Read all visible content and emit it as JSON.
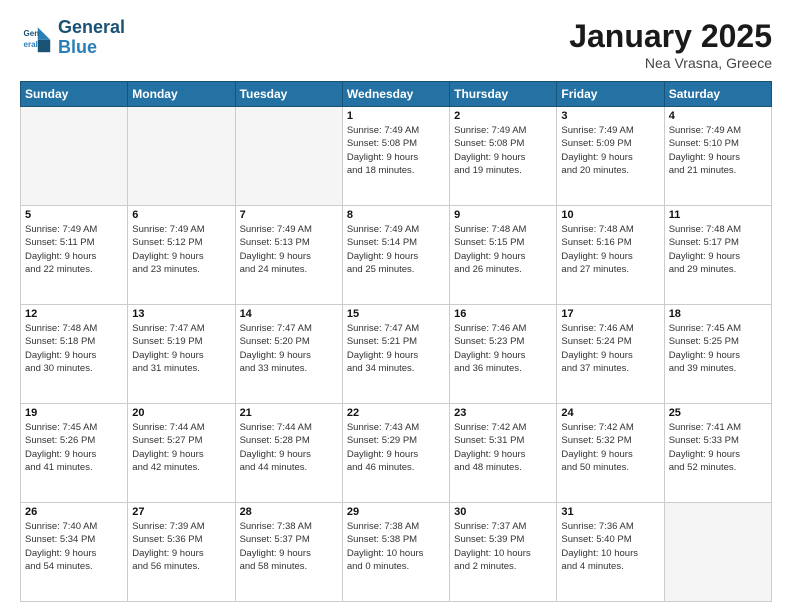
{
  "header": {
    "logo_line1": "General",
    "logo_line2": "Blue",
    "month_title": "January 2025",
    "location": "Nea Vrasna, Greece"
  },
  "weekdays": [
    "Sunday",
    "Monday",
    "Tuesday",
    "Wednesday",
    "Thursday",
    "Friday",
    "Saturday"
  ],
  "weeks": [
    [
      {
        "num": "",
        "info": "",
        "empty": true
      },
      {
        "num": "",
        "info": "",
        "empty": true
      },
      {
        "num": "",
        "info": "",
        "empty": true
      },
      {
        "num": "1",
        "info": "Sunrise: 7:49 AM\nSunset: 5:08 PM\nDaylight: 9 hours\nand 18 minutes.",
        "empty": false
      },
      {
        "num": "2",
        "info": "Sunrise: 7:49 AM\nSunset: 5:08 PM\nDaylight: 9 hours\nand 19 minutes.",
        "empty": false
      },
      {
        "num": "3",
        "info": "Sunrise: 7:49 AM\nSunset: 5:09 PM\nDaylight: 9 hours\nand 20 minutes.",
        "empty": false
      },
      {
        "num": "4",
        "info": "Sunrise: 7:49 AM\nSunset: 5:10 PM\nDaylight: 9 hours\nand 21 minutes.",
        "empty": false
      }
    ],
    [
      {
        "num": "5",
        "info": "Sunrise: 7:49 AM\nSunset: 5:11 PM\nDaylight: 9 hours\nand 22 minutes.",
        "empty": false
      },
      {
        "num": "6",
        "info": "Sunrise: 7:49 AM\nSunset: 5:12 PM\nDaylight: 9 hours\nand 23 minutes.",
        "empty": false
      },
      {
        "num": "7",
        "info": "Sunrise: 7:49 AM\nSunset: 5:13 PM\nDaylight: 9 hours\nand 24 minutes.",
        "empty": false
      },
      {
        "num": "8",
        "info": "Sunrise: 7:49 AM\nSunset: 5:14 PM\nDaylight: 9 hours\nand 25 minutes.",
        "empty": false
      },
      {
        "num": "9",
        "info": "Sunrise: 7:48 AM\nSunset: 5:15 PM\nDaylight: 9 hours\nand 26 minutes.",
        "empty": false
      },
      {
        "num": "10",
        "info": "Sunrise: 7:48 AM\nSunset: 5:16 PM\nDaylight: 9 hours\nand 27 minutes.",
        "empty": false
      },
      {
        "num": "11",
        "info": "Sunrise: 7:48 AM\nSunset: 5:17 PM\nDaylight: 9 hours\nand 29 minutes.",
        "empty": false
      }
    ],
    [
      {
        "num": "12",
        "info": "Sunrise: 7:48 AM\nSunset: 5:18 PM\nDaylight: 9 hours\nand 30 minutes.",
        "empty": false
      },
      {
        "num": "13",
        "info": "Sunrise: 7:47 AM\nSunset: 5:19 PM\nDaylight: 9 hours\nand 31 minutes.",
        "empty": false
      },
      {
        "num": "14",
        "info": "Sunrise: 7:47 AM\nSunset: 5:20 PM\nDaylight: 9 hours\nand 33 minutes.",
        "empty": false
      },
      {
        "num": "15",
        "info": "Sunrise: 7:47 AM\nSunset: 5:21 PM\nDaylight: 9 hours\nand 34 minutes.",
        "empty": false
      },
      {
        "num": "16",
        "info": "Sunrise: 7:46 AM\nSunset: 5:23 PM\nDaylight: 9 hours\nand 36 minutes.",
        "empty": false
      },
      {
        "num": "17",
        "info": "Sunrise: 7:46 AM\nSunset: 5:24 PM\nDaylight: 9 hours\nand 37 minutes.",
        "empty": false
      },
      {
        "num": "18",
        "info": "Sunrise: 7:45 AM\nSunset: 5:25 PM\nDaylight: 9 hours\nand 39 minutes.",
        "empty": false
      }
    ],
    [
      {
        "num": "19",
        "info": "Sunrise: 7:45 AM\nSunset: 5:26 PM\nDaylight: 9 hours\nand 41 minutes.",
        "empty": false
      },
      {
        "num": "20",
        "info": "Sunrise: 7:44 AM\nSunset: 5:27 PM\nDaylight: 9 hours\nand 42 minutes.",
        "empty": false
      },
      {
        "num": "21",
        "info": "Sunrise: 7:44 AM\nSunset: 5:28 PM\nDaylight: 9 hours\nand 44 minutes.",
        "empty": false
      },
      {
        "num": "22",
        "info": "Sunrise: 7:43 AM\nSunset: 5:29 PM\nDaylight: 9 hours\nand 46 minutes.",
        "empty": false
      },
      {
        "num": "23",
        "info": "Sunrise: 7:42 AM\nSunset: 5:31 PM\nDaylight: 9 hours\nand 48 minutes.",
        "empty": false
      },
      {
        "num": "24",
        "info": "Sunrise: 7:42 AM\nSunset: 5:32 PM\nDaylight: 9 hours\nand 50 minutes.",
        "empty": false
      },
      {
        "num": "25",
        "info": "Sunrise: 7:41 AM\nSunset: 5:33 PM\nDaylight: 9 hours\nand 52 minutes.",
        "empty": false
      }
    ],
    [
      {
        "num": "26",
        "info": "Sunrise: 7:40 AM\nSunset: 5:34 PM\nDaylight: 9 hours\nand 54 minutes.",
        "empty": false
      },
      {
        "num": "27",
        "info": "Sunrise: 7:39 AM\nSunset: 5:36 PM\nDaylight: 9 hours\nand 56 minutes.",
        "empty": false
      },
      {
        "num": "28",
        "info": "Sunrise: 7:38 AM\nSunset: 5:37 PM\nDaylight: 9 hours\nand 58 minutes.",
        "empty": false
      },
      {
        "num": "29",
        "info": "Sunrise: 7:38 AM\nSunset: 5:38 PM\nDaylight: 10 hours\nand 0 minutes.",
        "empty": false
      },
      {
        "num": "30",
        "info": "Sunrise: 7:37 AM\nSunset: 5:39 PM\nDaylight: 10 hours\nand 2 minutes.",
        "empty": false
      },
      {
        "num": "31",
        "info": "Sunrise: 7:36 AM\nSunset: 5:40 PM\nDaylight: 10 hours\nand 4 minutes.",
        "empty": false
      },
      {
        "num": "",
        "info": "",
        "empty": true
      }
    ]
  ]
}
